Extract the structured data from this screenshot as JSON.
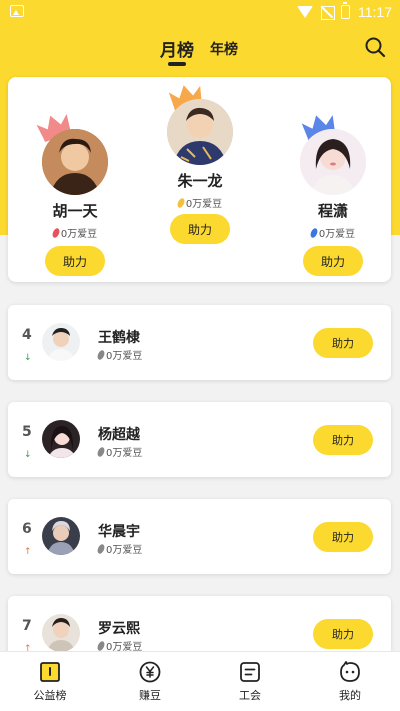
{
  "status_bar": {
    "time": "11:17"
  },
  "header": {
    "tabs": [
      {
        "label": "月榜",
        "active": true
      },
      {
        "label": "年榜",
        "active": false
      }
    ]
  },
  "top3": [
    {
      "rank": 2,
      "name": "胡一天",
      "beans": "0万爱豆",
      "help_label": "助力",
      "crown_color": "#f28a8a",
      "bean_color": "#e8505b"
    },
    {
      "rank": 1,
      "name": "朱一龙",
      "beans": "0万爱豆",
      "help_label": "助力",
      "crown_color": "#f7a84b",
      "bean_color": "#f5c03b"
    },
    {
      "rank": 3,
      "name": "程潇",
      "beans": "0万爱豆",
      "help_label": "助力",
      "crown_color": "#5b86e8",
      "bean_color": "#3a78e0"
    }
  ],
  "ranking": [
    {
      "rank": "4",
      "name": "王鹤棣",
      "beans": "0万爱豆",
      "trend": "down",
      "trend_symbol": "↓",
      "help_label": "助力"
    },
    {
      "rank": "5",
      "name": "杨超越",
      "beans": "0万爱豆",
      "trend": "down",
      "trend_symbol": "↓",
      "help_label": "助力"
    },
    {
      "rank": "6",
      "name": "华晨宇",
      "beans": "0万爱豆",
      "trend": "up",
      "trend_symbol": "↑",
      "help_label": "助力"
    },
    {
      "rank": "7",
      "name": "罗云熙",
      "beans": "0万爱豆",
      "trend": "up",
      "trend_symbol": "↑",
      "help_label": "助力"
    }
  ],
  "bottom_nav": [
    {
      "label": "公益榜",
      "icon": "charity-icon",
      "active": true
    },
    {
      "label": "赚豆",
      "icon": "yen-coin-icon",
      "active": false
    },
    {
      "label": "工会",
      "icon": "guild-icon",
      "active": false
    },
    {
      "label": "我的",
      "icon": "profile-icon",
      "active": false
    }
  ],
  "colors": {
    "accent": "#fcd92f",
    "trend_down": "#2fa44a",
    "trend_up": "#e07a4a"
  }
}
